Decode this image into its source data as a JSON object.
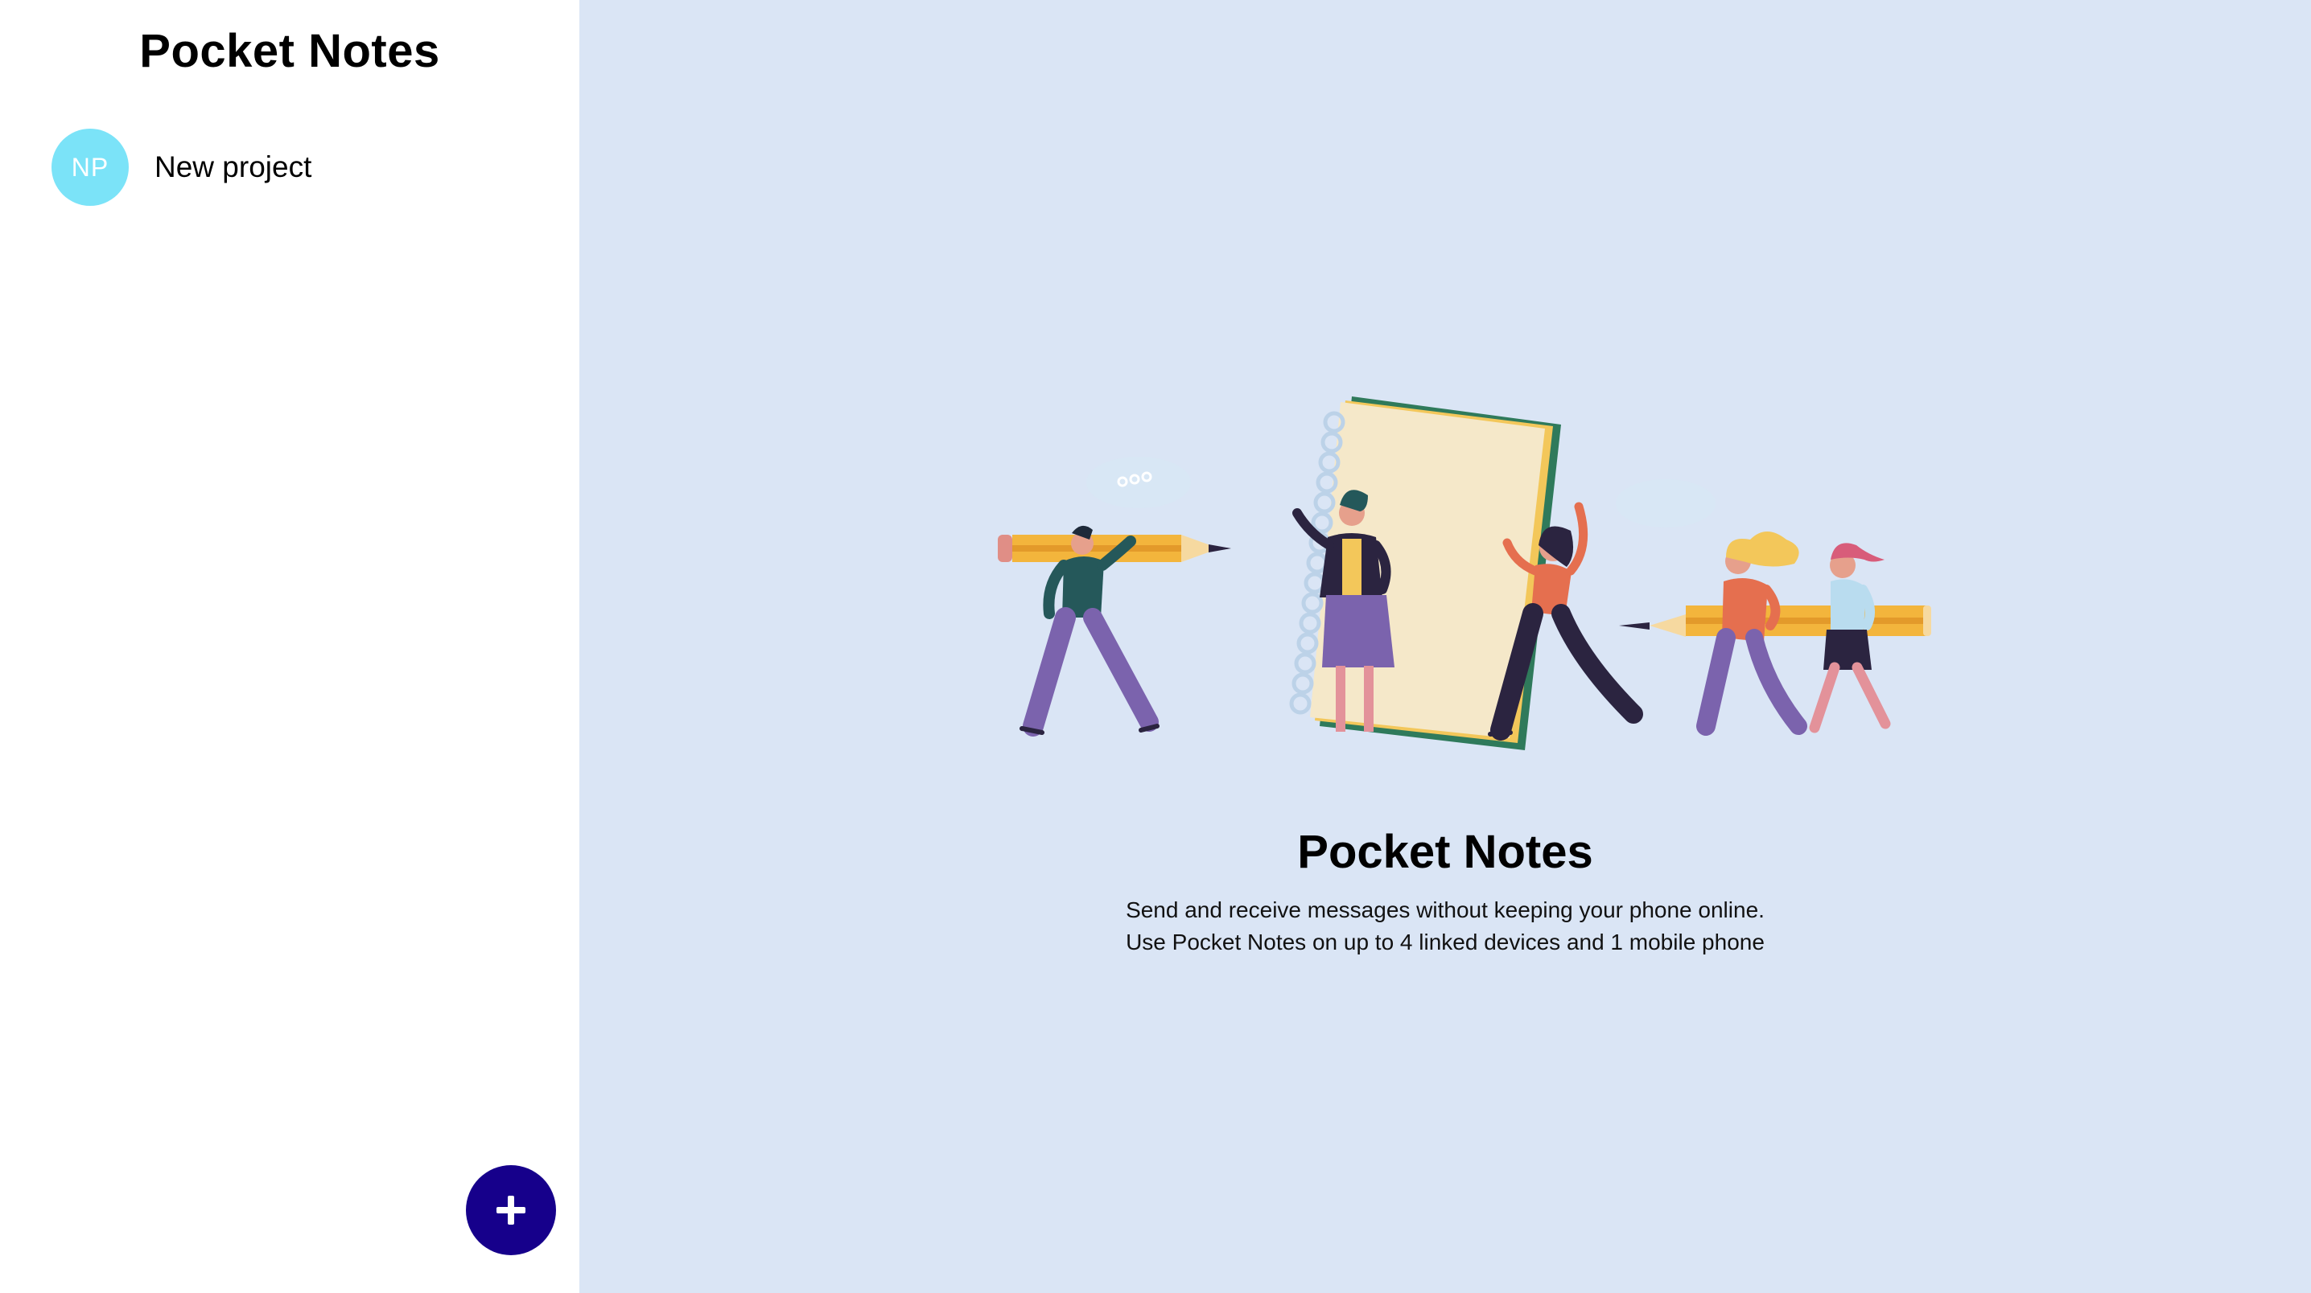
{
  "sidebar": {
    "title": "Pocket Notes",
    "groups": [
      {
        "initials": "NP",
        "name": "New project",
        "color": "#7be3f8"
      }
    ],
    "add_button": {
      "icon": "plus-icon",
      "color": "#16008b"
    }
  },
  "main": {
    "illustration": "people-with-pencils-and-notebook-illustration",
    "title": "Pocket Notes",
    "description_line1": "Send and receive messages without keeping your phone online.",
    "description_line2": "Use Pocket Notes on up to 4 linked devices and 1 mobile phone",
    "background": "#dae5f5"
  }
}
